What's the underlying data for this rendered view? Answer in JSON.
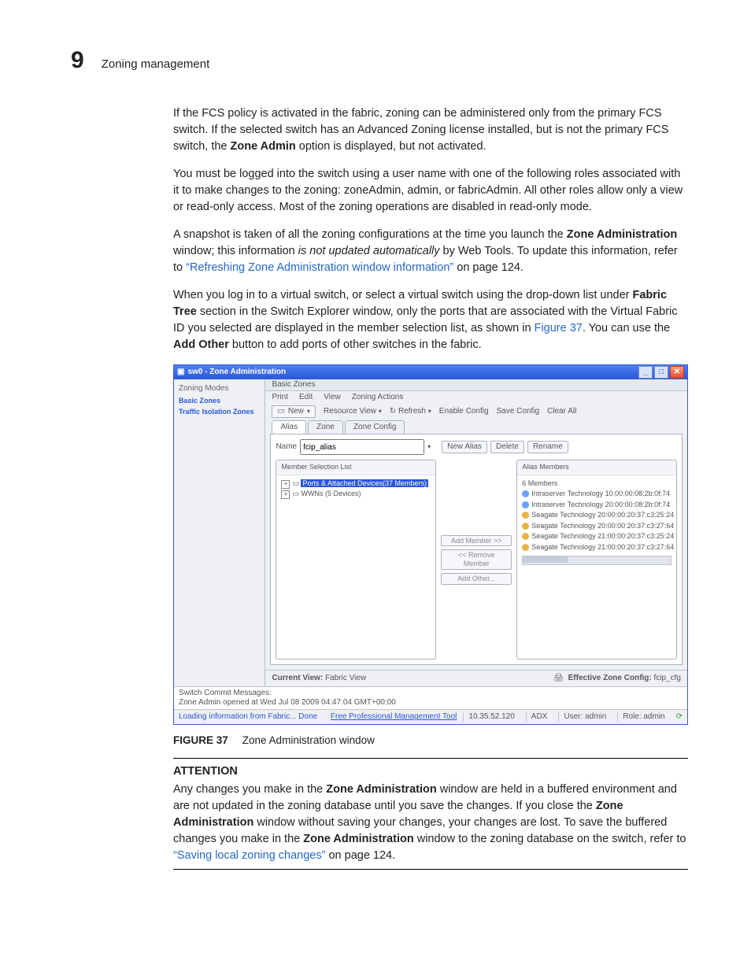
{
  "header": {
    "chapter_number": "9",
    "chapter_title": "Zoning management"
  },
  "paragraphs": {
    "p1a": "If the FCS policy is activated in the fabric, zoning can be administered only from the primary FCS switch. If the selected switch has an Advanced Zoning license installed, but is not the primary FCS switch, the ",
    "p1b": "Zone Admin",
    "p1c": " option is displayed, but not activated.",
    "p2": "You must be logged into the switch using a user name with one of the following roles associated with it to make changes to the zoning: zoneAdmin, admin, or fabricAdmin. All other roles allow only a view or read-only access. Most of the zoning operations are disabled in read-only mode.",
    "p3a": "A snapshot is taken of all the zoning configurations at the time you launch the ",
    "p3b": "Zone Administration",
    "p3c": " window; this information ",
    "p3d": "is not updated automatically",
    "p3e": " by Web Tools. To update this information, refer to ",
    "p3link": "“Refreshing Zone Administration window information”",
    "p3f": " on page 124.",
    "p4a": "When you log in to a virtual switch, or select a virtual switch using the drop-down list under ",
    "p4b": "Fabric Tree",
    "p4c": " section in the Switch Explorer window, only the ports that are associated with the Virtual Fabric ID you selected are displayed in the member selection list, as shown in ",
    "p4link": "Figure 37",
    "p4d": ". You can use the ",
    "p4e": "Add Other",
    "p4f": " button to add ports of other switches in the fabric."
  },
  "figure": {
    "label": "FIGURE 37",
    "caption": "Zone Administration window"
  },
  "attention": {
    "title": "ATTENTION",
    "a": "Any changes you make in the ",
    "b": "Zone Administration",
    "c": " window are held in a buffered environment and are not updated in the zoning database until you save the changes. If you close the ",
    "d": "Zone Administration",
    "e": " window without saving your changes, your changes are lost. To save the buffered changes you make in the ",
    "f": "Zone Administration",
    "g": " window to the zoning database on the switch, refer to ",
    "link": "“Saving local zoning changes”",
    "h": " on page 124."
  },
  "win": {
    "title": "sw0 - Zone Administration",
    "sidebar": {
      "header": "Zoning Modes",
      "items": [
        "Basic Zones",
        "Traffic Isolation Zones"
      ]
    },
    "crumb": "Basic Zones",
    "menus": [
      "Print",
      "Edit",
      "View",
      "Zoning Actions"
    ],
    "toolbar": {
      "new": "New",
      "resview": "Resource View",
      "refresh": "Refresh",
      "enable": "Enable Config",
      "save": "Save Config",
      "clear": "Clear All"
    },
    "tabs": [
      "Alias",
      "Zone",
      "Zone Config"
    ],
    "name_label": "Name",
    "name_value": "fcip_alias",
    "name_btns": [
      "New Alias",
      "Delete",
      "Rename"
    ],
    "left_panel_title": "Member Selection List",
    "tree": {
      "n1": "Ports & Attached Devices(37 Members)",
      "n2": "WWNs (5 Devices)"
    },
    "mid_btns": [
      "Add Member >>",
      "<< Remove Member",
      "Add Other..."
    ],
    "right_panel_title": "Alias Members",
    "right_header": "6 Members",
    "members": [
      "Intraserver Technology 10:00:00:08:2b:0f:74",
      "Intraserver Technology 20:00:00:08:2b:0f:74",
      "Seagate Technology 20:00:00:20:37:c3:25:24",
      "Seagate Technology 20:00:00:20:37:c3:27:64",
      "Seagate Technology 21:00:00:20:37:c3:25:24",
      "Seagate Technology 21:00:00:20:37:c3:27:64"
    ],
    "curview_label": "Current View:",
    "curview_value": "Fabric View",
    "effcfg_label": "Effective Zone Config:",
    "effcfg_value": "fcip_cfg",
    "msgs_label": "Switch Commit Messages:",
    "msgs_text": "Zone Admin opened at Wed Jul 08 2009 04:47:04 GMT+00:00",
    "status": {
      "loading": "Loading information from Fabric... Done",
      "tool": "Free Professional Management Tool",
      "ip": "10.35.52.120",
      "adx": "ADX",
      "user": "User: admin",
      "role": "Role: admin"
    }
  }
}
